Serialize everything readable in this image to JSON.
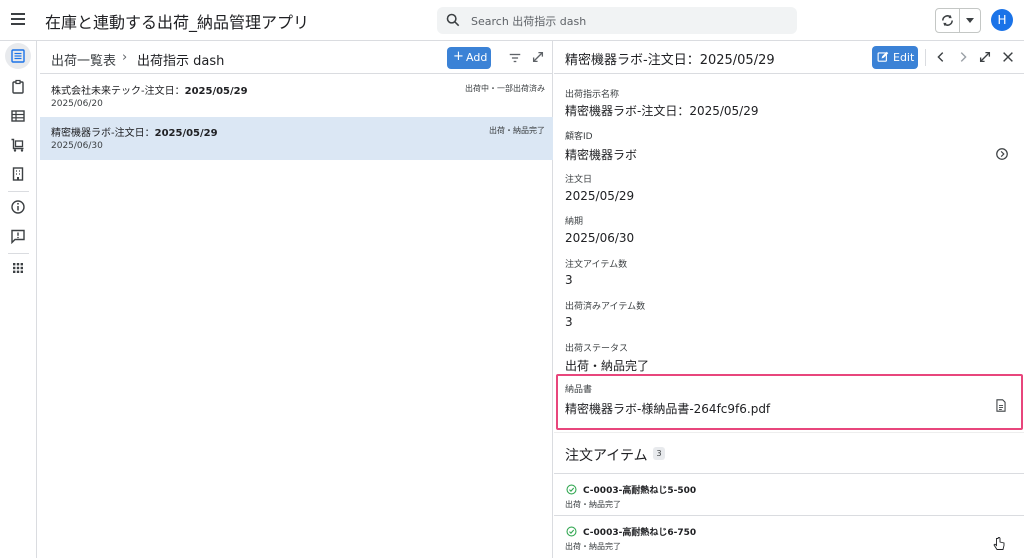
{
  "app": {
    "title": "在庫と連動する出荷_納品管理アプリ"
  },
  "search": {
    "placeholder": "Search 出荷指示 dash"
  },
  "user": {
    "avatar_letter": "H"
  },
  "colors": {
    "primary_button": "#3b82d6",
    "selected_row": "#dbe7f4",
    "highlight_border": "#e8467c",
    "check_green": "#34a853"
  },
  "rail": {
    "items": [
      {
        "icon": "list-view-icon",
        "active": true
      },
      {
        "icon": "clipboard-icon",
        "active": false
      },
      {
        "icon": "table-icon",
        "active": false
      },
      {
        "icon": "cart-icon",
        "active": false
      },
      {
        "icon": "building-icon",
        "active": false
      },
      {
        "icon": "info-icon",
        "active": false
      },
      {
        "icon": "feedback-icon",
        "active": false
      },
      {
        "icon": "apps-grid-icon",
        "active": false
      }
    ]
  },
  "list": {
    "breadcrumb_parent": "出荷一覧表",
    "breadcrumb_sep": "›",
    "breadcrumb_current": "出荷指示 dash",
    "add_label": "Add",
    "rows": [
      {
        "title_prefix": "株式会社未来テック-注文日：",
        "title_date": "2025/05/29",
        "sub": "2025/06/20",
        "status": "出荷中・一部出荷済み",
        "selected": false
      },
      {
        "title_prefix": "精密機器ラボ-注文日：",
        "title_date": "2025/05/29",
        "sub": "2025/06/30",
        "status": "出荷・納品完了",
        "selected": true
      }
    ]
  },
  "detail": {
    "title": "精密機器ラボ-注文日：2025/05/29",
    "edit_label": "Edit",
    "fields": [
      {
        "label": "出荷指示名称",
        "value": "精密機器ラボ-注文日：2025/05/29"
      },
      {
        "label": "顧客ID",
        "value": "精密機器ラボ"
      },
      {
        "label": "注文日",
        "value": "2025/05/29"
      },
      {
        "label": "納期",
        "value": "2025/06/30"
      },
      {
        "label": "注文アイテム数",
        "value": "3"
      },
      {
        "label": "出荷済みアイテム数",
        "value": "3"
      },
      {
        "label": "出荷ステータス",
        "value": "出荷・納品完了"
      },
      {
        "label": "納品書",
        "value": "精密機器ラボ-様納品書-264fc9f6.pdf"
      }
    ],
    "section_title": "注文アイテム",
    "section_count": "3",
    "items": [
      {
        "name": "C-0003-高耐熱ねじ5-500",
        "status": "出荷・納品完了"
      },
      {
        "name": "C-0003-高耐熱ねじ6-750",
        "status": "出荷・納品完了"
      }
    ]
  }
}
